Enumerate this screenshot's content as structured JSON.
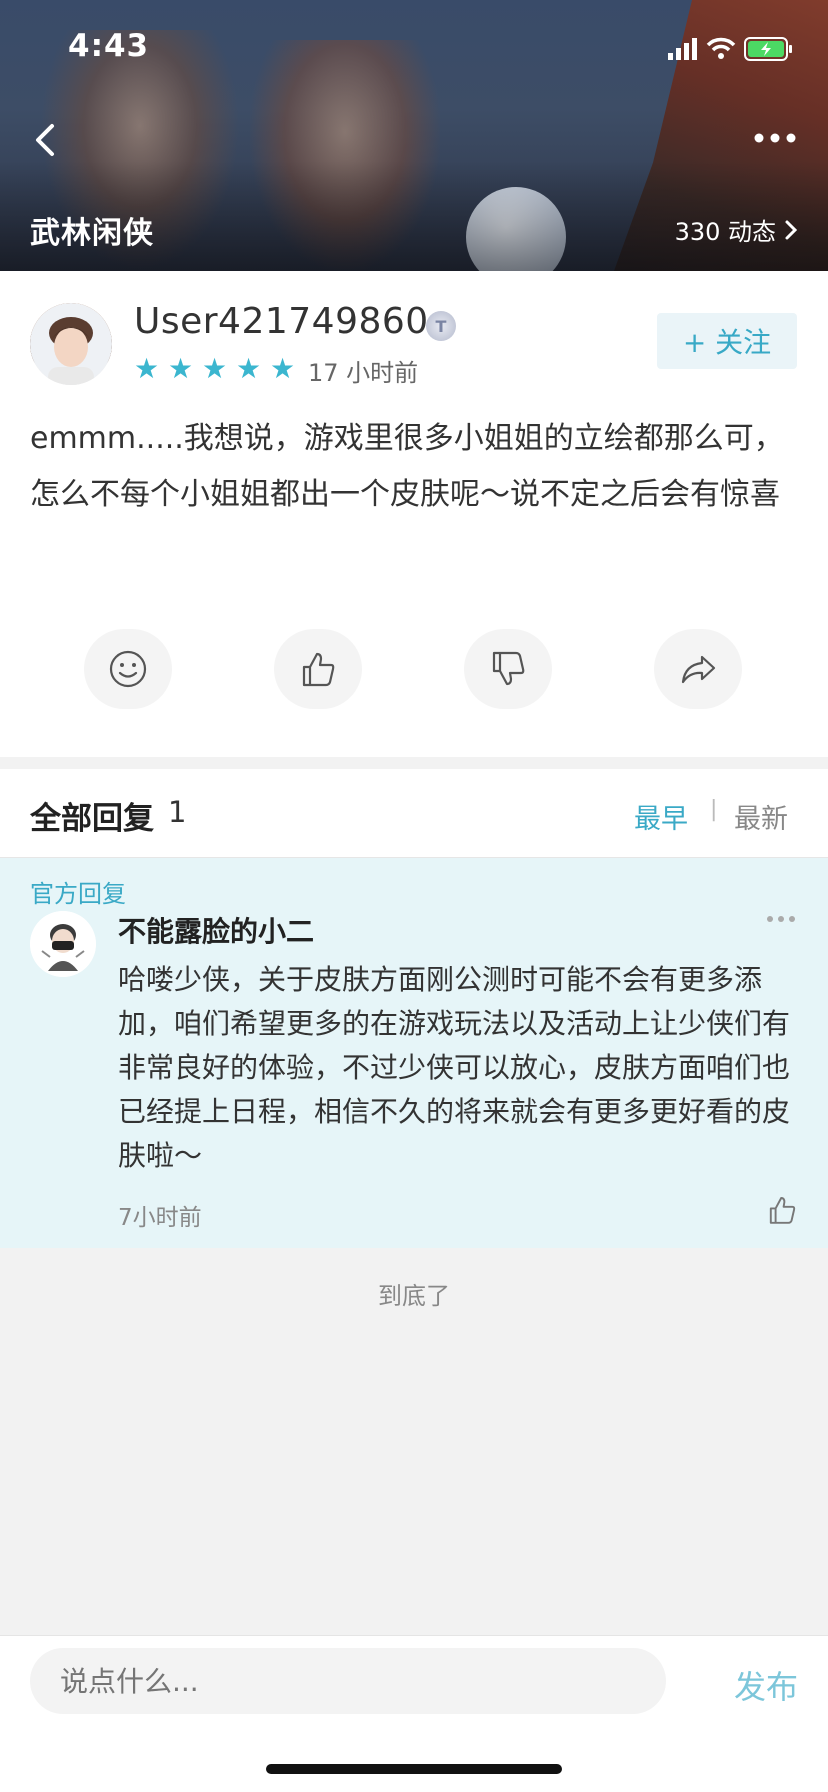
{
  "status_bar": {
    "time": "4:43"
  },
  "header": {
    "game_name": "武林闲侠",
    "activity_count": "330 动态",
    "brand_logo_text": "武林闲侠"
  },
  "post": {
    "username": "User421749860",
    "badge": "T",
    "rating_stars": 5,
    "time": "17 小时前",
    "follow_label": "+ 关注",
    "content": "emmm.....我想说，游戏里很多小姐姐的立绘都那么可，怎么不每个小姐姐都出一个皮肤呢～说不定之后会有惊喜",
    "actions": [
      "emoji-icon",
      "thumbs-up-icon",
      "thumbs-down-icon",
      "share-icon"
    ]
  },
  "replies": {
    "title": "全部回复",
    "count": "1",
    "sort_earliest": "最早",
    "sort_separator": "|",
    "sort_latest": "最新",
    "items": [
      {
        "official_label": "官方回复",
        "name": "不能露脸的小二",
        "text": "哈喽少侠，关于皮肤方面刚公测时可能不会有更多添加，咱们希望更多的在游戏玩法以及活动上让少侠们有非常良好的体验，不过少侠可以放心，皮肤方面咱们也已经提上日程，相信不久的将来就会有更多更好看的皮肤啦～",
        "time": "7小时前"
      }
    ],
    "end_text": "到底了"
  },
  "bottom_bar": {
    "input_placeholder": "说点什么...",
    "publish_label": "发布"
  },
  "colors": {
    "accent": "#3aa9c6",
    "official_bg": "#e6f5f8",
    "star": "#3bb6cf"
  }
}
